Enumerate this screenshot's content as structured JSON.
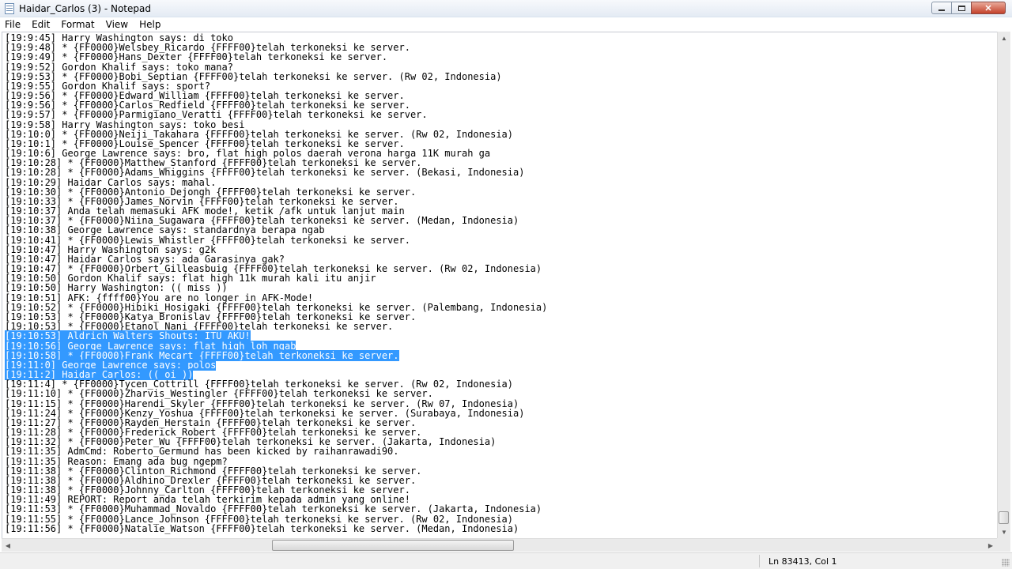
{
  "window": {
    "title": "Haidar_Carlos (3) - Notepad",
    "minimize_icon": "minimize-icon",
    "maximize_icon": "maximize-icon",
    "close_icon": "close-icon",
    "close_glyph": "✕"
  },
  "menu": [
    "File",
    "Edit",
    "Format",
    "View",
    "Help"
  ],
  "editor": {
    "lines": [
      {
        "text": "[19:9:45] Harry Washington says: di toko"
      },
      {
        "text": "[19:9:48] * {FF0000}Welsbey_Ricardo {FFFF00}telah terkoneksi ke server."
      },
      {
        "text": "[19:9:49] * {FF0000}Hans_Dexter {FFFF00}telah terkoneksi ke server."
      },
      {
        "text": "[19:9:52] Gordon Khalif says: toko mana?"
      },
      {
        "text": "[19:9:53] * {FF0000}Bobi_Septian {FFFF00}telah terkoneksi ke server. (Rw 02, Indonesia)"
      },
      {
        "text": "[19:9:55] Gordon Khalif says: sport?"
      },
      {
        "text": "[19:9:56] * {FF0000}Edward_William {FFFF00}telah terkoneksi ke server."
      },
      {
        "text": "[19:9:56] * {FF0000}Carlos_Redfield {FFFF00}telah terkoneksi ke server."
      },
      {
        "text": "[19:9:57] * {FF0000}Parmigiano_Veratti {FFFF00}telah terkoneksi ke server."
      },
      {
        "text": "[19:9:58] Harry Washington says: toko besi"
      },
      {
        "text": "[19:10:0] * {FF0000}Neiji_Takahara {FFFF00}telah terkoneksi ke server. (Rw 02, Indonesia)"
      },
      {
        "text": "[19:10:1] * {FF0000}Louise_Spencer {FFFF00}telah terkoneksi ke server."
      },
      {
        "text": "[19:10:6] George Lawrence says: bro, flat high polos daerah verona harga 11K murah ga"
      },
      {
        "text": "[19:10:28] * {FF0000}Matthew_Stanford {FFFF00}telah terkoneksi ke server."
      },
      {
        "text": "[19:10:28] * {FF0000}Adams_Whiggins {FFFF00}telah terkoneksi ke server. (Bekasi, Indonesia)"
      },
      {
        "text": "[19:10:29] Haidar Carlos says: mahal."
      },
      {
        "text": "[19:10:30] * {FF0000}Antonio_Dejongh {FFFF00}telah terkoneksi ke server."
      },
      {
        "text": "[19:10:33] * {FF0000}James_Norvin {FFFF00}telah terkoneksi ke server."
      },
      {
        "text": "[19:10:37] Anda telah memasuki AFK mode!, ketik /afk untuk lanjut main"
      },
      {
        "text": "[19:10:37] * {FF0000}Niina_Sugawara {FFFF00}telah terkoneksi ke server. (Medan, Indonesia)"
      },
      {
        "text": "[19:10:38] George Lawrence says: standardnya berapa ngab"
      },
      {
        "text": "[19:10:41] * {FF0000}Lewis_Whistler {FFFF00}telah terkoneksi ke server."
      },
      {
        "text": "[19:10:47] Harry Washington says: g2k"
      },
      {
        "text": "[19:10:47] Haidar Carlos says: ada Garasinya gak?"
      },
      {
        "text": "[19:10:47] * {FF0000}Orbert_Gilleasbuig {FFFF00}telah terkoneksi ke server. (Rw 02, Indonesia)"
      },
      {
        "text": "[19:10:50] Gordon Khalif says: flat high 11k murah kali itu anjir"
      },
      {
        "text": "[19:10:50] Harry Washington: (( miss ))"
      },
      {
        "text": "[19:10:51] AFK: {ffff00}You are no longer in AFK-Mode!"
      },
      {
        "text": "[19:10:52] * {FF0000}Hibiki_Hosigaki {FFFF00}telah terkoneksi ke server. (Palembang, Indonesia)"
      },
      {
        "text": "[19:10:53] * {FF0000}Katya_Bronislav {FFFF00}telah terkoneksi ke server."
      },
      {
        "text": "[19:10:53] * {FF0000}Etanol_Nani {FFFF00}telah terkoneksi ke server."
      },
      {
        "text": "[19:10:53] Aldrich Walters Shouts: ITU AKU!",
        "selected": true
      },
      {
        "text": "[19:10:56] George Lawrence says: flat high loh ngab",
        "selected": true
      },
      {
        "text": "[19:10:58] * {FF0000}Frank_Mecart {FFFF00}telah terkoneksi ke server.",
        "selected": true
      },
      {
        "text": "[19:11:0] George Lawrence says: polos",
        "selected": true
      },
      {
        "text": "[19:11:2] Haidar Carlos: (( oi ))",
        "selected": true
      },
      {
        "text": "[19:11:4] * {FF0000}Tycen_Cottrill {FFFF00}telah terkoneksi ke server. (Rw 02, Indonesia)"
      },
      {
        "text": "[19:11:10] * {FF0000}Zharvis_Westingler {FFFF00}telah terkoneksi ke server."
      },
      {
        "text": "[19:11:15] * {FF0000}Harendi_Skyler {FFFF00}telah terkoneksi ke server. (Rw 07, Indonesia)"
      },
      {
        "text": "[19:11:24] * {FF0000}Kenzy_Yoshua {FFFF00}telah terkoneksi ke server. (Surabaya, Indonesia)"
      },
      {
        "text": "[19:11:27] * {FF0000}Rayden_Herstain {FFFF00}telah terkoneksi ke server."
      },
      {
        "text": "[19:11:28] * {FF0000}Frederick_Robert {FFFF00}telah terkoneksi ke server."
      },
      {
        "text": "[19:11:32] * {FF0000}Peter_Wu {FFFF00}telah terkoneksi ke server. (Jakarta, Indonesia)"
      },
      {
        "text": "[19:11:35] AdmCmd: Roberto_Germund has been kicked by raihanrawadi90."
      },
      {
        "text": "[19:11:35] Reason: Emang ada bug ngepm?"
      },
      {
        "text": "[19:11:38] * {FF0000}Clinton_Richmond {FFFF00}telah terkoneksi ke server."
      },
      {
        "text": "[19:11:38] * {FF0000}Aldhino_Drexler {FFFF00}telah terkoneksi ke server."
      },
      {
        "text": "[19:11:38] * {FF0000}Johnny_Carlton {FFFF00}telah terkoneksi ke server."
      },
      {
        "text": "[19:11:49] REPORT: Report anda telah terkirim kepada admin yang online!"
      },
      {
        "text": "[19:11:53] * {FF0000}Muhammad_Novaldo {FFFF00}telah terkoneksi ke server. (Jakarta, Indonesia)"
      },
      {
        "text": "[19:11:55] * {FF0000}Lance_Johnson {FFFF00}telah terkoneksi ke server. (Rw 02, Indonesia)"
      },
      {
        "text": "[19:11:56] * {FF0000}Natalie_Watson {FFFF00}telah terkoneksi ke server. (Medan, Indonesia)"
      }
    ],
    "selection_color": "#3399ff"
  },
  "scrollbars": {
    "up_glyph": "▲",
    "down_glyph": "▼",
    "left_glyph": "◀",
    "right_glyph": "▶"
  },
  "status": {
    "position": "Ln 83413, Col 1"
  }
}
